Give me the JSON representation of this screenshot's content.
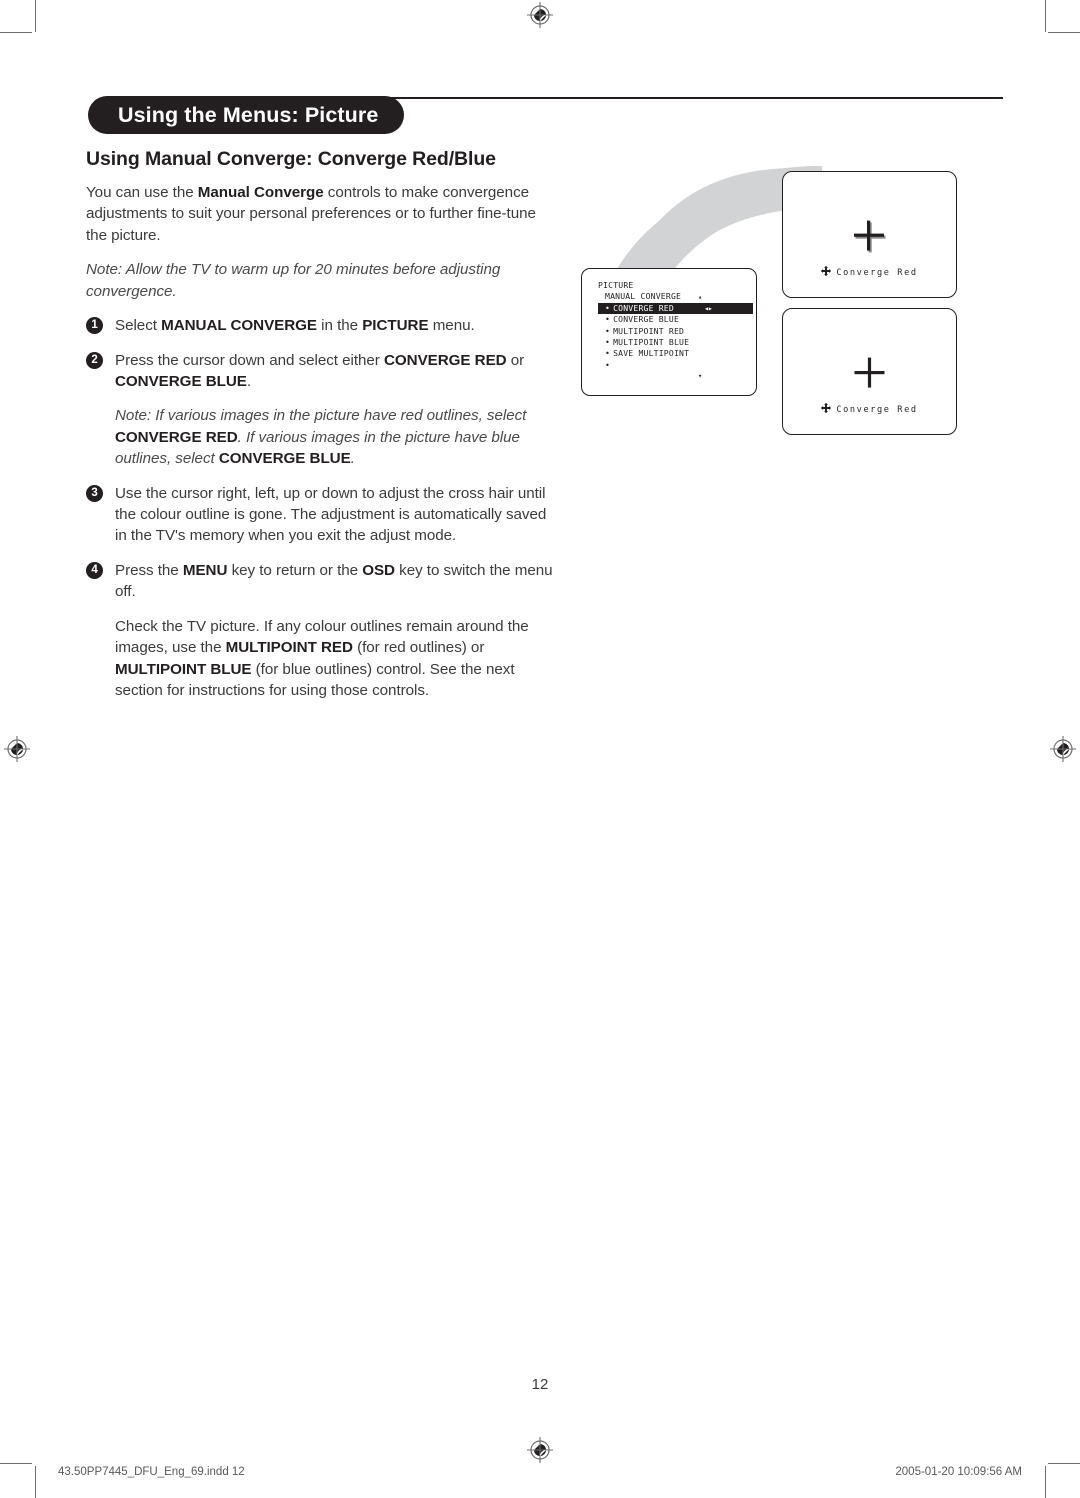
{
  "document": {
    "header_title": "Using the Menus: Picture",
    "section_title": "Using Manual Converge: Converge Red/Blue",
    "page_number": "12"
  },
  "intro": {
    "text_1": "You can use the ",
    "bold_1": "Manual Converge",
    "text_2": " controls to make convergence adjustments to suit your personal preferences or to further fine-tune the picture."
  },
  "note_top": {
    "text": "Note: Allow the TV to warm up for 20 minutes before adjusting convergence."
  },
  "steps": [
    {
      "number": "1",
      "text_1": "Select ",
      "bold_1": "MANUAL CONVERGE",
      "text_2": " in the ",
      "bold_2": "PICTURE",
      "text_3": " menu."
    },
    {
      "number": "2",
      "text_1": "Press the cursor down and select either ",
      "bold_1": "CONVERGE RED",
      "text_2": " or ",
      "bold_2": "CONVERGE BLUE",
      "text_3": "."
    },
    {
      "number": "3",
      "text_1": "Use the cursor right, left, up or down to adjust the cross hair until the colour outline is gone. The adjustment is automatically saved in the TV's memory when you exit the adjust mode."
    },
    {
      "number": "4",
      "text_1": "Press the ",
      "bold_1": "MENU",
      "text_2": " key to return or the ",
      "bold_2": "OSD",
      "text_3": " key to switch the menu off."
    }
  ],
  "note_step2": {
    "text_1": "Note: If various images in the picture have red outlines, select ",
    "bold_1": "CONVERGE RED",
    "text_2": ". If various images in the picture have blue outlines, select ",
    "bold_2": "CONVERGE BLUE",
    "text_3": "."
  },
  "closing": {
    "text_1": "Check the TV picture. If any colour outlines remain around the images, use the ",
    "bold_1": "MULTIPOINT RED",
    "text_2": " (for red outlines) or ",
    "bold_2": "MULTIPOINT BLUE",
    "text_3": " (for blue outlines) control. See the next section for instructions for using those controls."
  },
  "osd_menu": {
    "title": "PICTURE",
    "submenu": "MANUAL CONVERGE",
    "up_arrow": "▴",
    "down_arrow": "▾",
    "items": [
      {
        "bullet": "•",
        "label": "CONVERGE RED",
        "selected": true,
        "adjust_arrows": "◂▸"
      },
      {
        "bullet": "•",
        "label": "CONVERGE BLUE",
        "selected": false,
        "adjust_arrows": ""
      },
      {
        "bullet": "•",
        "label": "MULTIPOINT RED",
        "selected": false,
        "adjust_arrows": ""
      },
      {
        "bullet": "•",
        "label": "MULTIPOINT BLUE",
        "selected": false,
        "adjust_arrows": ""
      },
      {
        "bullet": "•",
        "label": "SAVE MULTIPOINT",
        "selected": false,
        "adjust_arrows": ""
      }
    ],
    "tail_bullet": "•"
  },
  "tv_previews": [
    {
      "label": "Converge  Red",
      "state": "misconverged",
      "description": "cross hair with grey offset ghost outline"
    },
    {
      "label": "Converge  Red",
      "state": "converged",
      "description": "clean single cross hair"
    }
  ],
  "footer": {
    "left": "43.50PP7445_DFU_Eng_69.indd   12",
    "right": "2005-01-20   10:09:56 AM"
  },
  "colors": {
    "ink": "#231f20",
    "body_text": "#3b3b3d",
    "swoosh_grey": "#d2d3d4",
    "crop_mark": "#6d6e71"
  }
}
